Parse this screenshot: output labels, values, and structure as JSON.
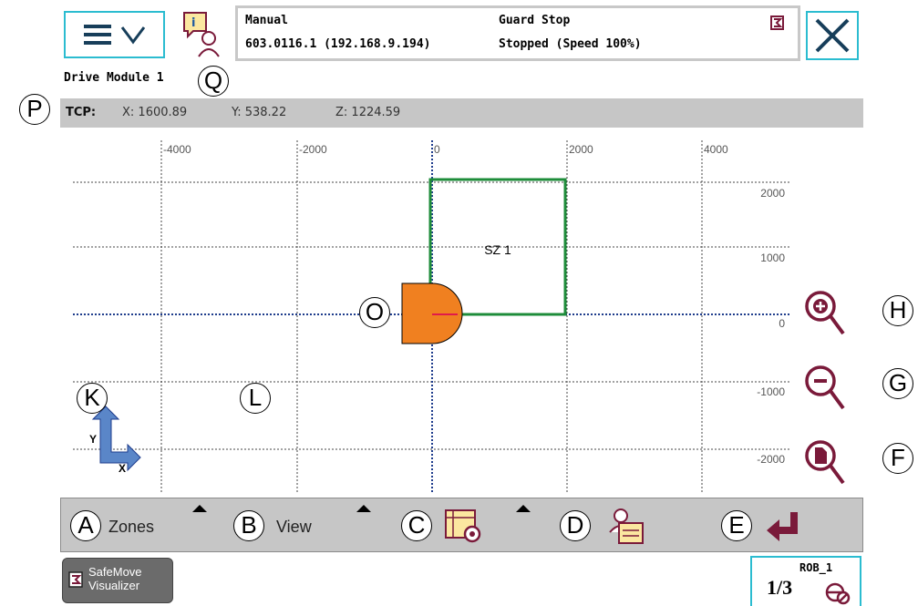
{
  "header": {
    "mode": "Manual",
    "controller": "603.0116.1 (192.168.9.194)",
    "safety": "Guard Stop",
    "run_state": "Stopped (Speed 100%)"
  },
  "module_title": "Drive Module 1",
  "tcp": {
    "label": "TCP:",
    "x": "X:  1600.89",
    "y": "Y:  538.22",
    "z": "Z:  1224.59"
  },
  "plot": {
    "x_ticks": [
      "-4000",
      "-2000",
      "0",
      "2000",
      "4000"
    ],
    "y_ticks": [
      "2000",
      "1000",
      "0",
      "-1000",
      "-2000"
    ],
    "zone_label": "SZ 1",
    "axis_y": "Y",
    "axis_x": "X"
  },
  "toolbar": {
    "zones": "Zones",
    "view": "View"
  },
  "callouts": {
    "A": "A",
    "B": "B",
    "C": "C",
    "D": "D",
    "E": "E",
    "F": "F",
    "G": "G",
    "H": "H",
    "K": "K",
    "L": "L",
    "O": "O",
    "P": "P",
    "Q": "Q"
  },
  "footer": {
    "app_line1": "SafeMove",
    "app_line2": "Visualizer",
    "robot": "ROB_1",
    "fraction": "1/3"
  },
  "colors": {
    "accent": "#2bbcd0",
    "zone": "#1e8c3a",
    "tool": "#f08020",
    "icon": "#7a1a3a",
    "toolbar": "#c6c6c6"
  }
}
